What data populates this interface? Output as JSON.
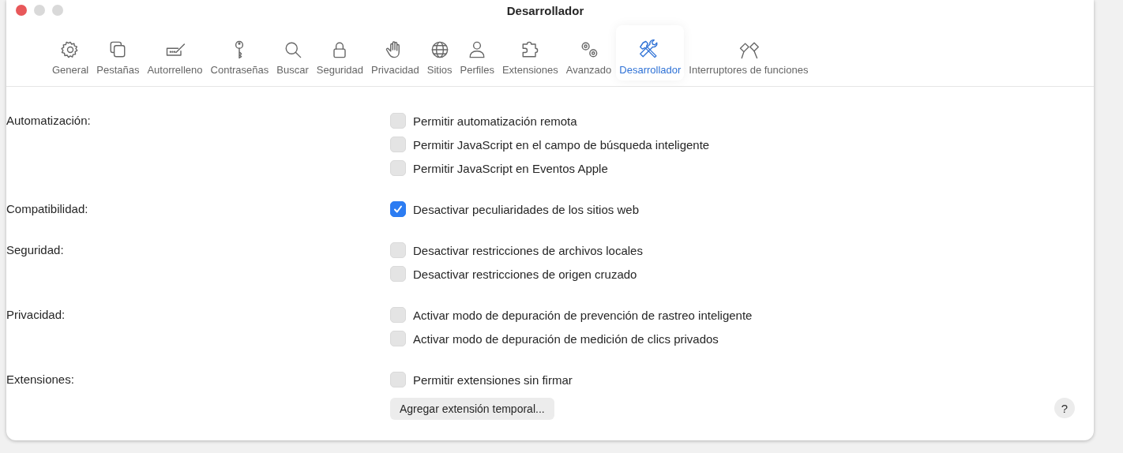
{
  "window": {
    "title": "Desarrollador"
  },
  "tabs": [
    {
      "label": "General",
      "selected": false
    },
    {
      "label": "Pestañas",
      "selected": false
    },
    {
      "label": "Autorrelleno",
      "selected": false
    },
    {
      "label": "Contraseñas",
      "selected": false
    },
    {
      "label": "Buscar",
      "selected": false
    },
    {
      "label": "Seguridad",
      "selected": false
    },
    {
      "label": "Privacidad",
      "selected": false
    },
    {
      "label": "Sitios",
      "selected": false
    },
    {
      "label": "Perfiles",
      "selected": false
    },
    {
      "label": "Extensiones",
      "selected": false
    },
    {
      "label": "Avanzado",
      "selected": false
    },
    {
      "label": "Desarrollador",
      "selected": true
    },
    {
      "label": "Interruptores de funciones",
      "selected": false
    }
  ],
  "sections": [
    {
      "label": "Automatización:",
      "options": [
        {
          "label": "Permitir automatización remota",
          "checked": false
        },
        {
          "label": "Permitir JavaScript en el campo de búsqueda inteligente",
          "checked": false
        },
        {
          "label": "Permitir JavaScript en Eventos Apple",
          "checked": false
        }
      ]
    },
    {
      "label": "Compatibilidad:",
      "options": [
        {
          "label": "Desactivar peculiaridades de los sitios web",
          "checked": true
        }
      ]
    },
    {
      "label": "Seguridad:",
      "options": [
        {
          "label": "Desactivar restricciones de archivos locales",
          "checked": false
        },
        {
          "label": "Desactivar restricciones de origen cruzado",
          "checked": false
        }
      ]
    },
    {
      "label": "Privacidad:",
      "options": [
        {
          "label": "Activar modo de depuración de prevención de rastreo inteligente",
          "checked": false
        },
        {
          "label": "Activar modo de depuración de medición de clics privados",
          "checked": false
        }
      ]
    },
    {
      "label": "Extensiones:",
      "options": [
        {
          "label": "Permitir extensiones sin firmar",
          "checked": false
        }
      ],
      "button": "Agregar extensión temporal..."
    }
  ],
  "help_button": "?"
}
